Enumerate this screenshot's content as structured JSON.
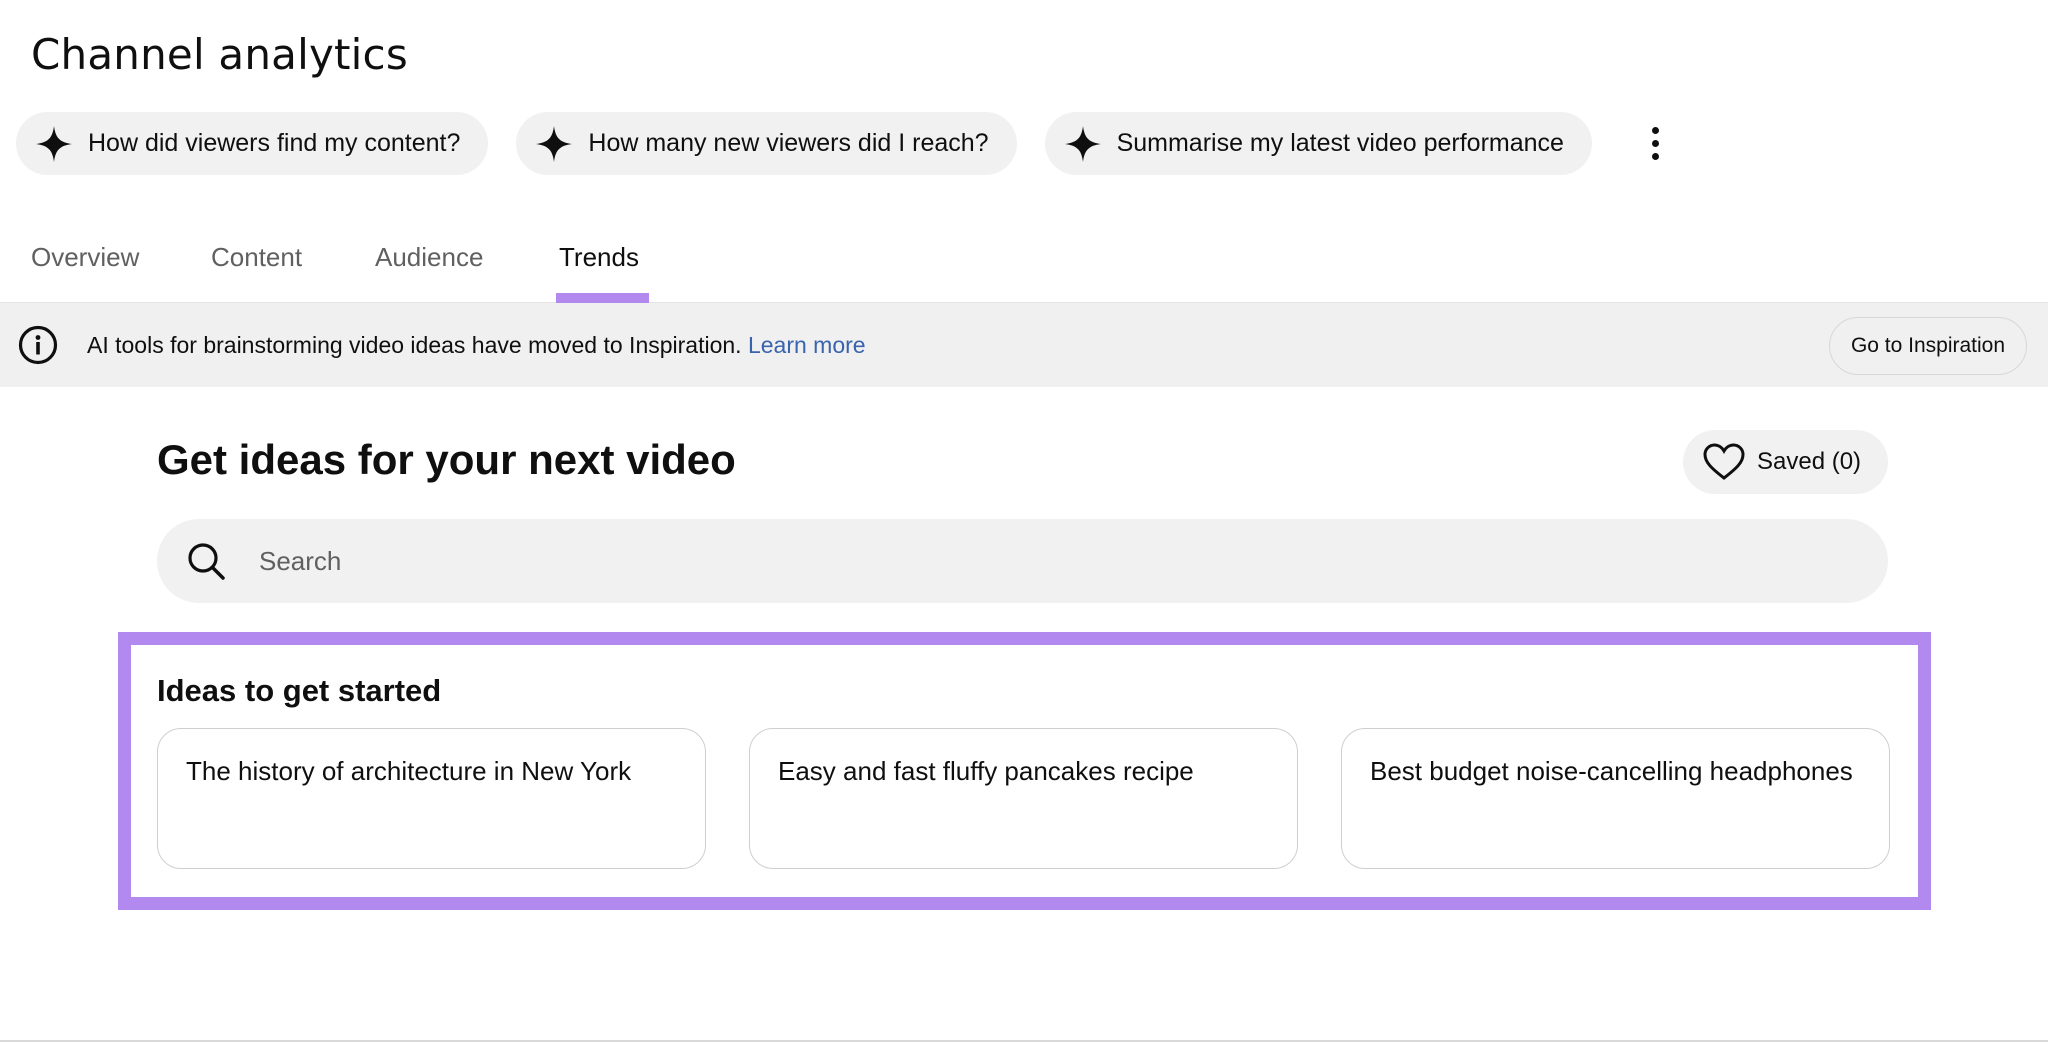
{
  "header": {
    "title": "Channel analytics"
  },
  "chips": [
    {
      "label": "How did viewers find my content?",
      "icon": "sparkle-icon"
    },
    {
      "label": "How many new viewers did I reach?",
      "icon": "sparkle-icon"
    },
    {
      "label": "Summarise my latest video performance",
      "icon": "sparkle-icon"
    }
  ],
  "tabs": [
    {
      "label": "Overview"
    },
    {
      "label": "Content"
    },
    {
      "label": "Audience"
    },
    {
      "label": "Trends",
      "active": true
    }
  ],
  "banner": {
    "message": "AI tools for brainstorming video ideas have moved to Inspiration.",
    "link": "Learn more",
    "button": "Go to Inspiration"
  },
  "main": {
    "title": "Get ideas for your next video",
    "saved_label": "Saved (0)",
    "search_placeholder": "Search",
    "section_title": "Ideas to get started",
    "ideas": [
      "The history of architecture in New York",
      "Easy and fast fluffy pancakes recipe",
      "Best budget noise-cancelling headphones"
    ]
  },
  "colors": {
    "accent": "#b28aef",
    "link": "#3a63ad",
    "chip_bg": "#f1f1f1",
    "banner_bg": "#f0f0f0"
  }
}
